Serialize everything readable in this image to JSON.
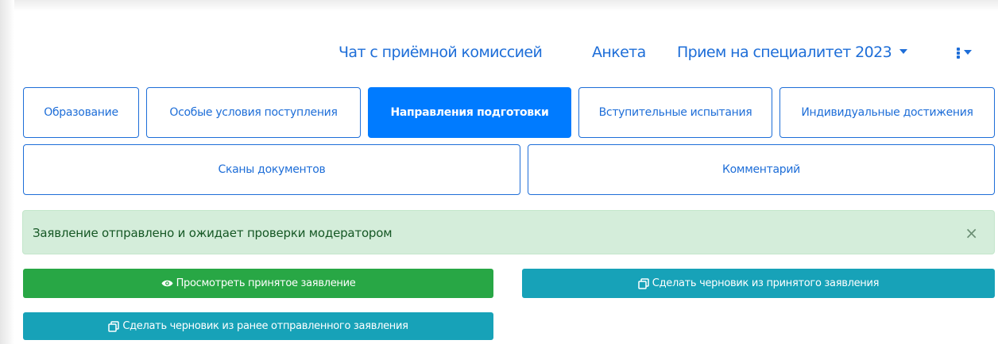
{
  "nav": {
    "chat_label": "Чат с приёмной комиссией",
    "form_label": "Анкета",
    "campaign_label": "Прием на специалитет 2023"
  },
  "tabs": [
    {
      "label": "Образование",
      "active": false
    },
    {
      "label": "Особые условия поступления",
      "active": false
    },
    {
      "label": "Направления подготовки",
      "active": true
    },
    {
      "label": "Вступительные испытания",
      "active": false
    },
    {
      "label": "Индивидуальные достижения",
      "active": false
    },
    {
      "label": "Сканы документов",
      "active": false
    },
    {
      "label": "Комментарий",
      "active": false
    }
  ],
  "alert": {
    "text": "Заявление отправлено и ожидает проверки модератором",
    "close_label": "×"
  },
  "actions": {
    "view_accepted": "Просмотреть принятое заявление",
    "draft_from_accepted": "Сделать черновик из принятого заявления",
    "draft_from_sent": "Сделать черновик из ранее отправленного заявления"
  },
  "icons": {
    "view": "eye-icon",
    "copy": "copy-icon",
    "more": "kebab-icon"
  },
  "colors": {
    "primary": "#007bff",
    "link": "#1e6ed8",
    "success": "#28a745",
    "info": "#17a2b8",
    "alert_bg": "#d4edda",
    "alert_text": "#155724"
  }
}
